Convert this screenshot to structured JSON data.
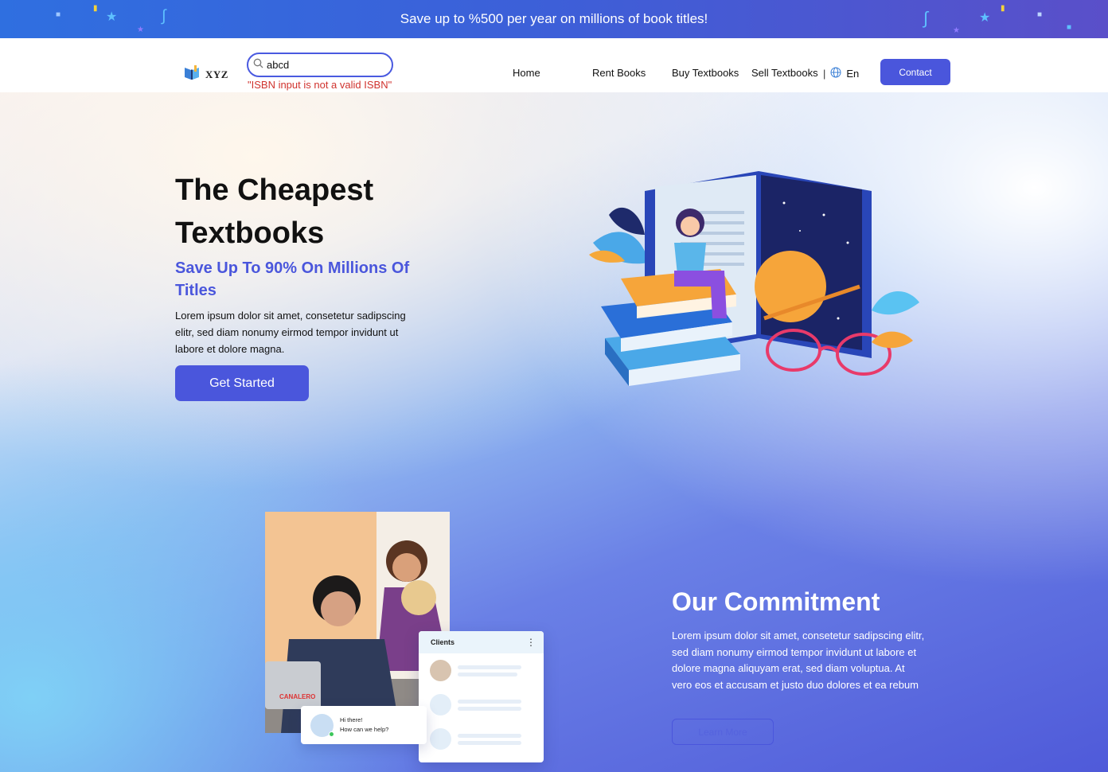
{
  "promo": {
    "text": "Save up to %500 per year on millions of book titles!"
  },
  "header": {
    "logo_text": "XYZ",
    "search": {
      "value": "abcd",
      "placeholder": "",
      "error": "\"ISBN input is not a valid ISBN\""
    },
    "nav": [
      {
        "label": "Home"
      },
      {
        "label": "Rent Books"
      },
      {
        "label": "Buy Textbooks"
      },
      {
        "label": "Sell Textbooks"
      }
    ],
    "language": "En",
    "contact_label": "Contact"
  },
  "hero": {
    "title": "The Cheapest Textbooks",
    "subtitle": "Save Up To 90% On Millions Of Titles",
    "body": "Lorem ipsum dolor sit amet, consetetur sadipscing elitr, sed diam nonumy eirmod tempor invidunt ut labore et dolore magna.",
    "cta_label": "Get Started"
  },
  "commitment": {
    "title": "Our Commitment",
    "body": "Lorem ipsum dolor sit amet, consetetur sadipscing elitr, sed diam nonumy eirmod tempor invidunt ut labore et dolore magna aliquyam erat, sed diam voluptua. At vero eos et accusam et justo duo dolores et ea rebum",
    "cta_label": "Learn More",
    "clients_card": {
      "title": "Clients"
    },
    "chat_card": {
      "line1": "Hi there!",
      "line2": "How can we help?"
    }
  },
  "colors": {
    "primary": "#4a56dc",
    "error": "#d0332e",
    "promo_start": "#2f6fe0",
    "promo_end": "#5a4fc9"
  }
}
